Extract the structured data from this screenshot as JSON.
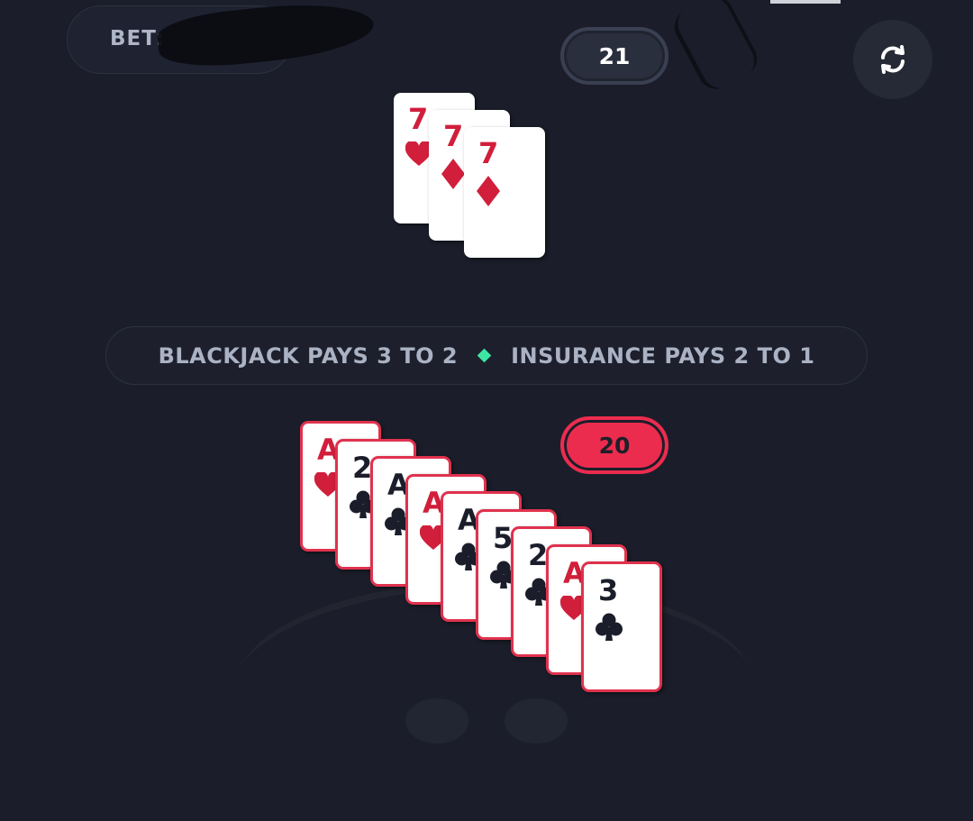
{
  "header": {
    "bet_label": "BET:",
    "bet_value": "",
    "refresh_icon": "refresh-icon"
  },
  "dealer": {
    "score": "21",
    "cards": [
      {
        "rank": "7",
        "suit": "hearts",
        "color": "#d11f3b"
      },
      {
        "rank": "7",
        "suit": "diamonds",
        "color": "#d11f3b"
      },
      {
        "rank": "7",
        "suit": "diamonds",
        "color": "#d11f3b"
      }
    ]
  },
  "info": {
    "left_text": "BLACKJACK PAYS 3 TO 2",
    "right_text": "INSURANCE PAYS 2 TO 1",
    "separator_color": "#3ee6a3"
  },
  "player": {
    "score": "20",
    "accent_color": "#ec2c4e",
    "cards": [
      {
        "rank": "A",
        "suit": "hearts"
      },
      {
        "rank": "2",
        "suit": "clubs"
      },
      {
        "rank": "A",
        "suit": "clubs"
      },
      {
        "rank": "A",
        "suit": "hearts"
      },
      {
        "rank": "A",
        "suit": "clubs"
      },
      {
        "rank": "5",
        "suit": "clubs"
      },
      {
        "rank": "2",
        "suit": "clubs"
      },
      {
        "rank": "A",
        "suit": "hearts"
      },
      {
        "rank": "3",
        "suit": "clubs"
      }
    ]
  }
}
